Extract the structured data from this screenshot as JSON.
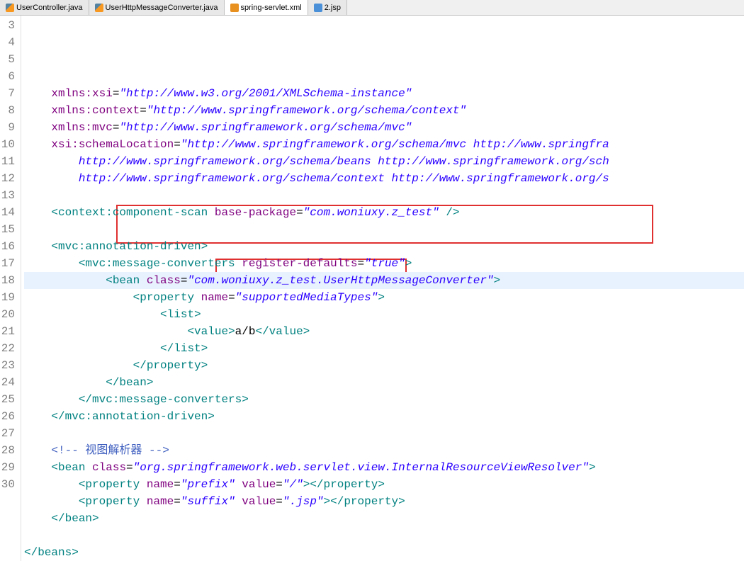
{
  "tabs": [
    {
      "label": "UserController.java",
      "icon": "java",
      "active": false
    },
    {
      "label": "UserHttpMessageConverter.java",
      "icon": "java",
      "active": false
    },
    {
      "label": "spring-servlet.xml",
      "icon": "xml",
      "active": true
    },
    {
      "label": "2.jsp",
      "icon": "jsp",
      "active": false
    }
  ],
  "lineStart": 3,
  "lines": {
    "l3": {
      "indent": "    ",
      "tokens": [
        {
          "t": "attr",
          "v": "xmlns:xsi"
        },
        {
          "t": "text",
          "v": "="
        },
        {
          "t": "str",
          "v": "\"http://www.w3.org/2001/XMLSchema-instance\""
        }
      ]
    },
    "l4": {
      "indent": "    ",
      "tokens": [
        {
          "t": "attr",
          "v": "xmlns:context"
        },
        {
          "t": "text",
          "v": "="
        },
        {
          "t": "str",
          "v": "\"http://www.springframework.org/schema/context\""
        }
      ]
    },
    "l5": {
      "indent": "    ",
      "tokens": [
        {
          "t": "attr",
          "v": "xmlns:mvc"
        },
        {
          "t": "text",
          "v": "="
        },
        {
          "t": "str",
          "v": "\"http://www.springframework.org/schema/mvc\""
        }
      ]
    },
    "l6": {
      "indent": "    ",
      "tokens": [
        {
          "t": "attr",
          "v": "xsi:schemaLocation"
        },
        {
          "t": "text",
          "v": "="
        },
        {
          "t": "str",
          "v": "\"http://www.springframework.org/schema/mvc http://www.springfra"
        }
      ]
    },
    "l7": {
      "indent": "        ",
      "tokens": [
        {
          "t": "str",
          "v": "http://www.springframework.org/schema/beans http://www.springframework.org/sch"
        }
      ]
    },
    "l8": {
      "indent": "        ",
      "tokens": [
        {
          "t": "str",
          "v": "http://www.springframework.org/schema/context http://www.springframework.org/s"
        }
      ]
    },
    "l9": {
      "indent": "",
      "tokens": []
    },
    "l10": {
      "indent": "    ",
      "tokens": [
        {
          "t": "tag",
          "v": "<context:component-scan"
        },
        {
          "t": "text",
          "v": " "
        },
        {
          "t": "attr",
          "v": "base-package"
        },
        {
          "t": "text",
          "v": "="
        },
        {
          "t": "str",
          "v": "\"com.woniuxy.z_test\""
        },
        {
          "t": "text",
          "v": " "
        },
        {
          "t": "tag",
          "v": "/>"
        }
      ]
    },
    "l11": {
      "indent": "",
      "tokens": []
    },
    "l12": {
      "indent": "    ",
      "tokens": [
        {
          "t": "tag",
          "v": "<mvc:annotation-driven>"
        }
      ]
    },
    "l13": {
      "indent": "        ",
      "tokens": [
        {
          "t": "tag",
          "v": "<mvc:message-converters"
        },
        {
          "t": "text",
          "v": " "
        },
        {
          "t": "attr",
          "v": "register-defaults"
        },
        {
          "t": "text",
          "v": "="
        },
        {
          "t": "str",
          "v": "\"true\""
        },
        {
          "t": "tag",
          "v": ">"
        }
      ]
    },
    "l14": {
      "indent": "            ",
      "hl": true,
      "tokens": [
        {
          "t": "tag",
          "v": "<bean"
        },
        {
          "t": "text",
          "v": " "
        },
        {
          "t": "attr",
          "v": "class"
        },
        {
          "t": "text",
          "v": "="
        },
        {
          "t": "str",
          "v": "\"com.woniuxy.z_test.UserHttpMessageConverter\""
        },
        {
          "t": "tag",
          "v": ">"
        }
      ]
    },
    "l15": {
      "indent": "                ",
      "tokens": [
        {
          "t": "tag",
          "v": "<property"
        },
        {
          "t": "text",
          "v": " "
        },
        {
          "t": "attr",
          "v": "name"
        },
        {
          "t": "text",
          "v": "="
        },
        {
          "t": "str",
          "v": "\"supportedMediaTypes\""
        },
        {
          "t": "tag",
          "v": ">"
        }
      ]
    },
    "l16": {
      "indent": "                    ",
      "tokens": [
        {
          "t": "tag",
          "v": "<list>"
        }
      ]
    },
    "l17": {
      "indent": "                        ",
      "tokens": [
        {
          "t": "tag",
          "v": "<value>"
        },
        {
          "t": "text",
          "v": "a/b"
        },
        {
          "t": "tag",
          "v": "</value>"
        }
      ]
    },
    "l18": {
      "indent": "                    ",
      "tokens": [
        {
          "t": "tag",
          "v": "</list>"
        }
      ]
    },
    "l19": {
      "indent": "                ",
      "tokens": [
        {
          "t": "tag",
          "v": "</property>"
        }
      ]
    },
    "l20": {
      "indent": "            ",
      "tokens": [
        {
          "t": "tag",
          "v": "</bean>"
        }
      ]
    },
    "l21": {
      "indent": "        ",
      "tokens": [
        {
          "t": "tag",
          "v": "</mvc:message-converters>"
        }
      ]
    },
    "l22": {
      "indent": "    ",
      "tokens": [
        {
          "t": "tag",
          "v": "</mvc:annotation-driven>"
        }
      ]
    },
    "l23": {
      "indent": "",
      "tokens": []
    },
    "l24": {
      "indent": "    ",
      "tokens": [
        {
          "t": "comment",
          "v": "<!-- 视图解析器 -->"
        }
      ]
    },
    "l25": {
      "indent": "    ",
      "tokens": [
        {
          "t": "tag",
          "v": "<bean"
        },
        {
          "t": "text",
          "v": " "
        },
        {
          "t": "attr",
          "v": "class"
        },
        {
          "t": "text",
          "v": "="
        },
        {
          "t": "str",
          "v": "\"org.springframework.web.servlet.view.InternalResourceViewResolver\""
        },
        {
          "t": "tag",
          "v": ">"
        }
      ]
    },
    "l26": {
      "indent": "        ",
      "tokens": [
        {
          "t": "tag",
          "v": "<property"
        },
        {
          "t": "text",
          "v": " "
        },
        {
          "t": "attr",
          "v": "name"
        },
        {
          "t": "text",
          "v": "="
        },
        {
          "t": "str",
          "v": "\"prefix\""
        },
        {
          "t": "text",
          "v": " "
        },
        {
          "t": "attr",
          "v": "value"
        },
        {
          "t": "text",
          "v": "="
        },
        {
          "t": "str",
          "v": "\"/\""
        },
        {
          "t": "tag",
          "v": "></property>"
        }
      ]
    },
    "l27": {
      "indent": "        ",
      "tokens": [
        {
          "t": "tag",
          "v": "<property"
        },
        {
          "t": "text",
          "v": " "
        },
        {
          "t": "attr",
          "v": "name"
        },
        {
          "t": "text",
          "v": "="
        },
        {
          "t": "str",
          "v": "\"suffix\""
        },
        {
          "t": "text",
          "v": " "
        },
        {
          "t": "attr",
          "v": "value"
        },
        {
          "t": "text",
          "v": "="
        },
        {
          "t": "str",
          "v": "\".jsp\""
        },
        {
          "t": "tag",
          "v": "></property>"
        }
      ]
    },
    "l28": {
      "indent": "    ",
      "tokens": [
        {
          "t": "tag",
          "v": "</bean>"
        }
      ]
    },
    "l29": {
      "indent": "",
      "tokens": []
    },
    "l30": {
      "indent": "",
      "tokens": [
        {
          "t": "tag",
          "v": "</beans>"
        }
      ]
    }
  }
}
